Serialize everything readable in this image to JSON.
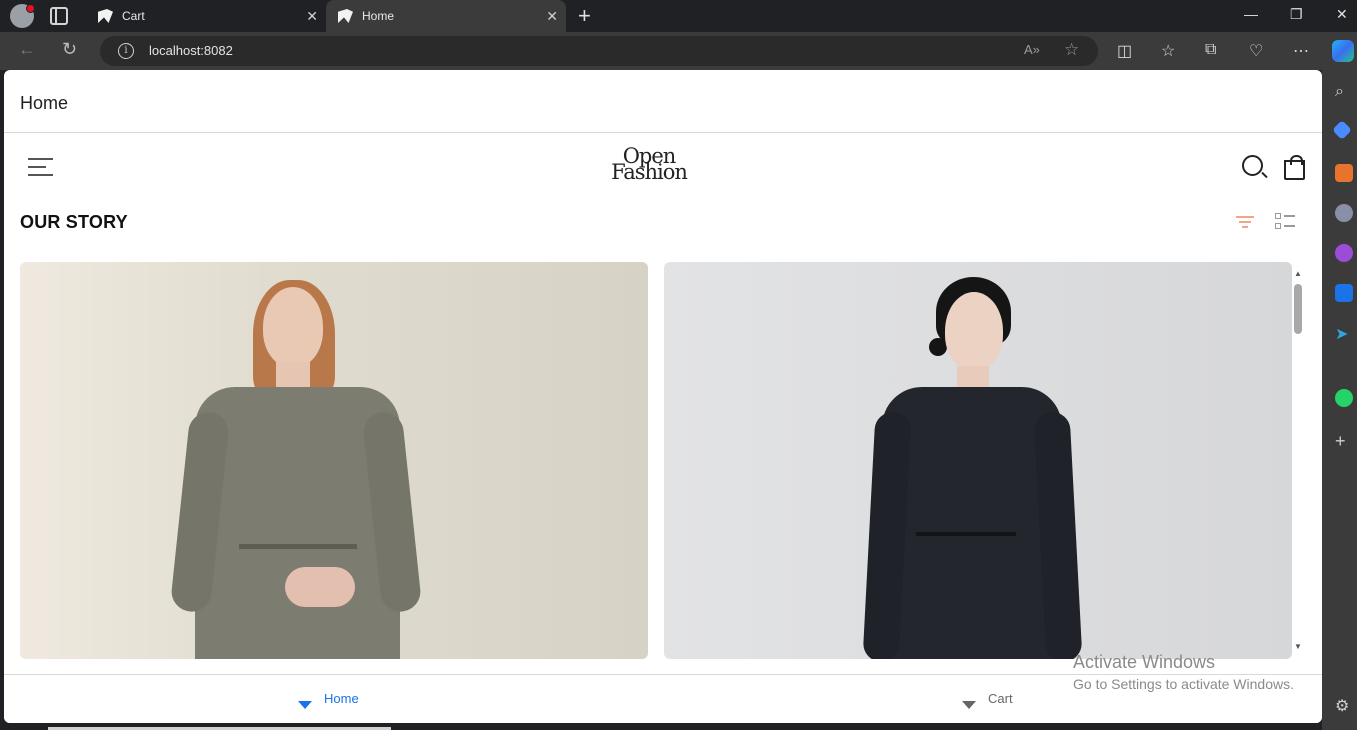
{
  "browser": {
    "tabs": [
      {
        "label": "Cart",
        "active": false
      },
      {
        "label": "Home",
        "active": true
      }
    ],
    "address": "localhost:8082",
    "watermark": {
      "title": "Activate Windows",
      "subtitle": "Go to Settings to activate Windows."
    }
  },
  "app": {
    "appbar_title": "Home",
    "logo": {
      "line1": "Open",
      "line2": "Fashion"
    },
    "section_title": "OUR STORY",
    "bottom_nav": [
      {
        "label": "Home",
        "active": true
      },
      {
        "label": "Cart",
        "active": false
      }
    ]
  },
  "colors": {
    "active_nav": "#1a73e8",
    "filter_accent": "#f0a48a"
  },
  "icons": {
    "menu": "hamburger-icon",
    "search": "search-icon",
    "bag": "shopping-bag-icon",
    "filter": "filter-icon",
    "view": "list-view-icon"
  }
}
